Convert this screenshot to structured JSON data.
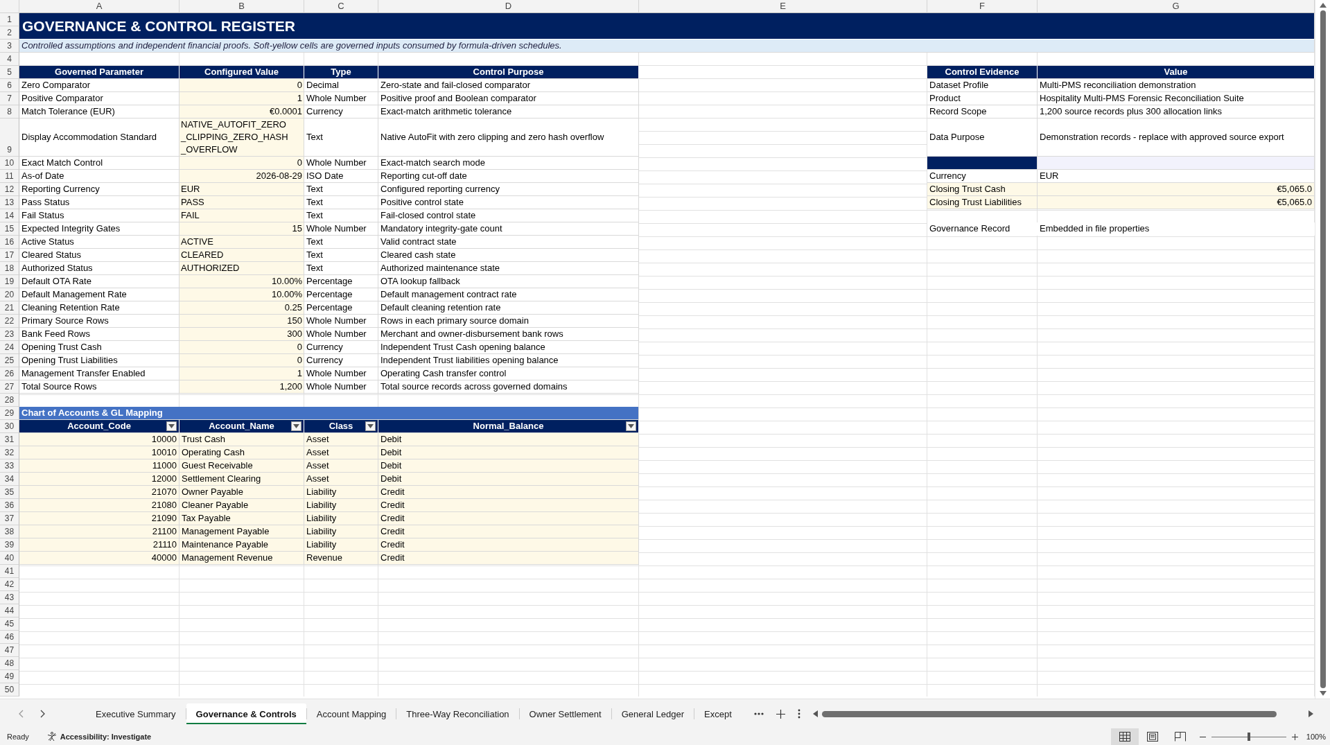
{
  "column_letters": [
    "A",
    "B",
    "C",
    "D",
    "E",
    "F",
    "G"
  ],
  "row_numbers": [
    "1",
    "2",
    "3",
    "4",
    "5",
    "6",
    "7",
    "8",
    "9",
    "10",
    "11",
    "12",
    "13",
    "14",
    "15",
    "16",
    "17",
    "18",
    "19",
    "20",
    "21",
    "22",
    "23",
    "24",
    "25",
    "26",
    "27",
    "28",
    "29",
    "30",
    "31",
    "32",
    "33",
    "34",
    "35",
    "36",
    "37",
    "38",
    "39",
    "40",
    "41",
    "42",
    "43",
    "44",
    "45",
    "46",
    "47",
    "48",
    "49",
    "50"
  ],
  "title": "GOVERNANCE & CONTROL REGISTER",
  "subtitle": "Controlled assumptions and independent financial proofs. Soft-yellow cells are governed inputs consumed by formula-driven schedules.",
  "parameters": {
    "columns": [
      "Governed Parameter",
      "Configured Value",
      "Type",
      "Control Purpose"
    ],
    "rows": [
      {
        "parameter": "Zero Comparator",
        "value": "0",
        "kind": "number",
        "type": "Decimal",
        "purpose": "Zero-state and fail-closed comparator"
      },
      {
        "parameter": "Positive Comparator",
        "value": "1",
        "kind": "number",
        "type": "Whole Number",
        "purpose": "Positive proof and Boolean comparator"
      },
      {
        "parameter": "Match Tolerance (EUR)",
        "value": "€0.0001",
        "kind": "number",
        "type": "Currency",
        "purpose": "Exact-match arithmetic tolerance"
      },
      {
        "parameter": "Display Accommodation Standard",
        "value": "NATIVE_AUTOFIT_ZERO_CLIPPING_ZERO_HASH_OVERFLOW",
        "kind": "text",
        "type": "Text",
        "purpose": "Native AutoFit with zero clipping and zero hash overflow"
      },
      {
        "parameter": "Exact Match Control",
        "value": "0",
        "kind": "number",
        "type": "Whole Number",
        "purpose": "Exact-match search mode"
      },
      {
        "parameter": "As-of Date",
        "value": "2026-08-29",
        "kind": "number",
        "type": "ISO Date",
        "purpose": "Reporting cut-off date"
      },
      {
        "parameter": "Reporting Currency",
        "value": "EUR",
        "kind": "text",
        "type": "Text",
        "purpose": "Configured reporting currency"
      },
      {
        "parameter": "Pass Status",
        "value": "PASS",
        "kind": "text",
        "type": "Text",
        "purpose": "Positive control state"
      },
      {
        "parameter": "Fail Status",
        "value": "FAIL",
        "kind": "text",
        "type": "Text",
        "purpose": "Fail-closed control state"
      },
      {
        "parameter": "Expected Integrity Gates",
        "value": "15",
        "kind": "number",
        "type": "Whole Number",
        "purpose": "Mandatory integrity-gate count"
      },
      {
        "parameter": "Active Status",
        "value": "ACTIVE",
        "kind": "text",
        "type": "Text",
        "purpose": "Valid contract state"
      },
      {
        "parameter": "Cleared Status",
        "value": "CLEARED",
        "kind": "text",
        "type": "Text",
        "purpose": "Cleared cash state"
      },
      {
        "parameter": "Authorized Status",
        "value": "AUTHORIZED",
        "kind": "text",
        "type": "Text",
        "purpose": "Authorized maintenance state"
      },
      {
        "parameter": "Default OTA Rate",
        "value": "10.00%",
        "kind": "number",
        "type": "Percentage",
        "purpose": "OTA lookup fallback"
      },
      {
        "parameter": "Default Management Rate",
        "value": "10.00%",
        "kind": "number",
        "type": "Percentage",
        "purpose": "Default management contract rate"
      },
      {
        "parameter": "Cleaning Retention Rate",
        "value": "0.25",
        "kind": "number",
        "type": "Percentage",
        "purpose": "Default cleaning retention rate"
      },
      {
        "parameter": "Primary Source Rows",
        "value": "150",
        "kind": "number",
        "type": "Whole Number",
        "purpose": "Rows in each primary source domain"
      },
      {
        "parameter": "Bank Feed Rows",
        "value": "300",
        "kind": "number",
        "type": "Whole Number",
        "purpose": "Merchant and owner-disbursement bank rows"
      },
      {
        "parameter": "Opening Trust Cash",
        "value": "0",
        "kind": "number",
        "type": "Currency",
        "purpose": "Independent Trust Cash opening balance"
      },
      {
        "parameter": "Opening Trust Liabilities",
        "value": "0",
        "kind": "number",
        "type": "Currency",
        "purpose": "Independent Trust liabilities opening balance"
      },
      {
        "parameter": "Management Transfer Enabled",
        "value": "1",
        "kind": "number",
        "type": "Whole Number",
        "purpose": "Operating Cash transfer control"
      },
      {
        "parameter": "Total Source Rows",
        "value": "1,200",
        "kind": "number",
        "type": "Whole Number",
        "purpose": "Total source records across governed domains"
      }
    ]
  },
  "chart_of_accounts": {
    "title": "Chart of Accounts & GL Mapping",
    "columns": [
      {
        "label": "Account_Code",
        "filter": true
      },
      {
        "label": "Account_Name",
        "filter": true
      },
      {
        "label": "Class",
        "filter": true
      },
      {
        "label": "Normal_Balance",
        "filter": true
      }
    ],
    "rows": [
      {
        "code": "10000",
        "name": "Trust Cash",
        "class": "Asset",
        "balance": "Debit"
      },
      {
        "code": "10010",
        "name": "Operating Cash",
        "class": "Asset",
        "balance": "Debit"
      },
      {
        "code": "11000",
        "name": "Guest Receivable",
        "class": "Asset",
        "balance": "Debit"
      },
      {
        "code": "12000",
        "name": "Settlement Clearing",
        "class": "Asset",
        "balance": "Debit"
      },
      {
        "code": "21070",
        "name": "Owner Payable",
        "class": "Liability",
        "balance": "Credit"
      },
      {
        "code": "21080",
        "name": "Cleaner Payable",
        "class": "Liability",
        "balance": "Credit"
      },
      {
        "code": "21090",
        "name": "Tax Payable",
        "class": "Liability",
        "balance": "Credit"
      },
      {
        "code": "21100",
        "name": "Management Payable",
        "class": "Liability",
        "balance": "Credit"
      },
      {
        "code": "21110",
        "name": "Maintenance Payable",
        "class": "Liability",
        "balance": "Credit"
      },
      {
        "code": "40000",
        "name": "Management Revenue",
        "class": "Revenue",
        "balance": "Credit"
      }
    ]
  },
  "control_evidence": {
    "columns": [
      "Control Evidence",
      "Value"
    ],
    "rows": [
      {
        "kind": "text",
        "label": "Dataset Profile",
        "value": "Multi-PMS reconciliation demonstration"
      },
      {
        "kind": "text",
        "label": "Product",
        "value": "Hospitality Multi-PMS Forensic Reconciliation Suite"
      },
      {
        "kind": "text",
        "label": "Record Scope",
        "value": "1,200 source records plus 300 allocation links"
      },
      {
        "kind": "text",
        "label": "Data Purpose",
        "value": "Demonstration records - replace with approved source export"
      },
      {
        "kind": "band"
      },
      {
        "kind": "text",
        "label": "Currency",
        "value": "EUR"
      },
      {
        "kind": "amount",
        "label": "Closing Trust Cash",
        "value": "€5,065.0"
      },
      {
        "kind": "amount",
        "label": "Closing Trust Liabilities",
        "value": "€5,065.0"
      }
    ],
    "governance_record": {
      "label": "Governance Record",
      "value": "Embedded in file properties"
    }
  },
  "sheet_tabs": [
    {
      "label": "Executive Summary",
      "selected": false
    },
    {
      "label": "Governance & Controls",
      "selected": true
    },
    {
      "label": "Account Mapping",
      "selected": false
    },
    {
      "label": "Three-Way Reconciliation",
      "selected": false
    },
    {
      "label": "Owner Settlement",
      "selected": false
    },
    {
      "label": "General Ledger",
      "selected": false
    },
    {
      "label": "Except",
      "selected": false
    }
  ],
  "status_bar": {
    "ready": "Ready",
    "accessibility": "Accessibility: Investigate",
    "views": [
      {
        "kind": "normal",
        "selected": true
      },
      {
        "kind": "page_layout",
        "selected": false
      },
      {
        "kind": "page_break",
        "selected": false
      }
    ],
    "zoom": {
      "level": 0.5,
      "label": "100%"
    }
  }
}
